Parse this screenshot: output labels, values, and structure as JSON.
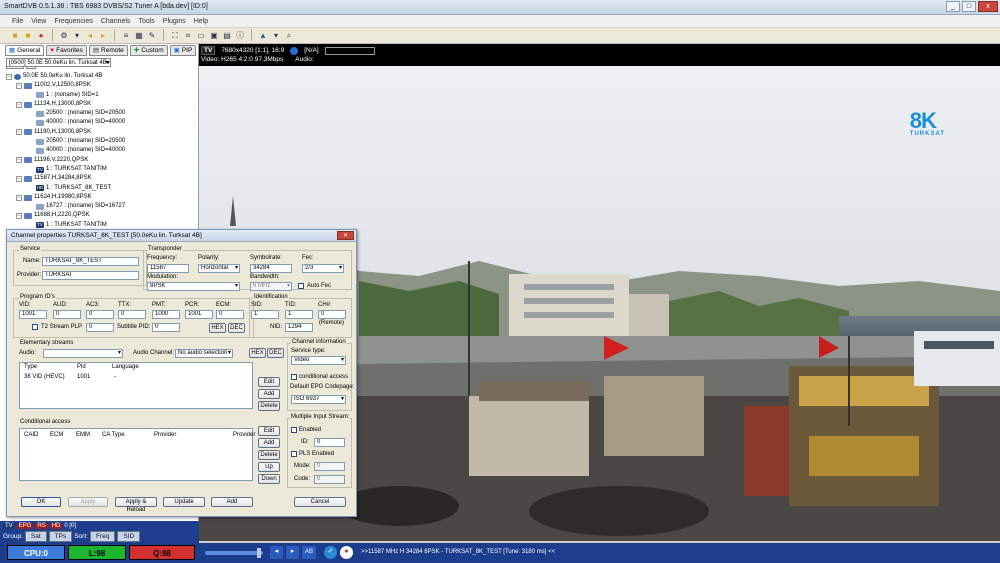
{
  "window": {
    "title": "SmartDVB 0.5.1.38 : TBS 6983 DVBS/S2 Tuner A [bda.dev]  [ID:0]",
    "min": "_",
    "max": "□",
    "close": "x"
  },
  "menu": [
    "File",
    "View",
    "Frequencies",
    "Channels",
    "Tools",
    "Plugins",
    "Help"
  ],
  "left_panel": {
    "tabs": [
      "General",
      "Favorites",
      "Remote",
      "Custom",
      "PIP"
    ],
    "channel_select": "[0500] 50.0E 50.0eKu lin. Turksat 4B",
    "tree": [
      {
        "level": 0,
        "icon": "sat",
        "text": "50.0E 50.0eKu lin. Turksat 4B"
      },
      {
        "level": 1,
        "icon": "tp",
        "text": "11002,V,12500,8PSK"
      },
      {
        "level": 2,
        "icon": "svc",
        "text": "1 : (noname) SID=1"
      },
      {
        "level": 1,
        "icon": "tp",
        "text": "11134,H,13000,8PSK"
      },
      {
        "level": 2,
        "icon": "svc",
        "text": "20500 : (noname) SID=20500"
      },
      {
        "level": 2,
        "icon": "svc",
        "text": "40000 : (noname) SID=40000"
      },
      {
        "level": 1,
        "icon": "tp",
        "text": "11190,H,13000,8PSK"
      },
      {
        "level": 2,
        "icon": "svc",
        "text": "20500 : (noname) SID=20500"
      },
      {
        "level": 2,
        "icon": "svc",
        "text": "40000 : (noname) SID=40000"
      },
      {
        "level": 1,
        "icon": "tp",
        "text": "11196,V,2220,QPSK"
      },
      {
        "level": 2,
        "icon": "tv",
        "text": "1 : TURKSAT TANITIM"
      },
      {
        "level": 1,
        "icon": "tp",
        "text": "11587,H,34284,8PSK"
      },
      {
        "level": 2,
        "icon": "hd",
        "text": "1 : TURKSAT_8K_TEST"
      },
      {
        "level": 1,
        "icon": "tp",
        "text": "11624,H,19980,8PSK"
      },
      {
        "level": 2,
        "icon": "svc",
        "text": "16727 : (noname) SID=16727"
      },
      {
        "level": 1,
        "icon": "tp",
        "text": "11688,H,2220,QPSK"
      },
      {
        "level": 2,
        "icon": "tv",
        "text": "1 : TURKSAT TANITIM"
      }
    ],
    "status_pills": [
      "TV",
      "EPG",
      "RS",
      "HD",
      "0 [0]"
    ],
    "group_label": "Group:",
    "group_buttons": [
      "Sat",
      "TPs"
    ],
    "sort_label": "Sort:",
    "sort_buttons": [
      "Freq",
      "SID"
    ]
  },
  "video": {
    "tv_badge": "TV",
    "resolution": "7680x4320 [1:1], 16:9",
    "audio_state": "[N/A]",
    "codec_info": "Video: H265  4:2:0  97.3Mbps",
    "audio_label": "Audio:",
    "logo_text": "8K",
    "logo_sub": "TURKSAT"
  },
  "statusbar": {
    "cpu": "CPU:0",
    "level": "L:98",
    "quality": "Q:98",
    "info": ">>11587 MHz H 34284 8PSK - TURKSAT_8K_TEST [Tune: 3180 ms] <<",
    "buttons": [
      "◂",
      "▸",
      "AB",
      "✓",
      "●"
    ]
  },
  "dialog": {
    "title": "Channel properties TURKSAT_8K_TEST [50.0eKu lin. Turksat 4B]",
    "service": {
      "group": "Service",
      "name_label": "Name:",
      "name": "TURKSAT_8K_TEST",
      "provider_label": "Provider:",
      "provider": "TURKSAT"
    },
    "transponder": {
      "group": "Transponder",
      "freq_label": "Frequency:",
      "freq": "11587",
      "pol_label": "Polarity:",
      "pol": "Horizontal",
      "sym_label": "Symbolrate:",
      "sym": "34284",
      "fec_label": "Fec:",
      "fec": "2/3",
      "mod_label": "Modulation:",
      "mod": "8PSK",
      "bw_label": "Bandwidth:",
      "bw": "6 MHz",
      "autofec_label": "Auto Fec"
    },
    "pids": {
      "group": "Program ID's",
      "vid_label": "VID:",
      "vid": "1001",
      "aud_label": "AUD:",
      "aud": "0",
      "ac3_label": "AC3:",
      "ac3": "0",
      "ttx_label": "TTX:",
      "ttx": "0",
      "pmt_label": "PMT:",
      "pmt": "1000",
      "pcr_label": "PCR:",
      "pcr": "1001",
      "ecm_label": "ECM:",
      "ecm": "0",
      "t2_label": "T2 Stream PLP",
      "t2": "0",
      "sub_label": "Subtitle PID:",
      "sub": "0",
      "hex": "HEX",
      "dec": "DEC"
    },
    "ident": {
      "group": "Identification",
      "sid_label": "SID:",
      "sid": "1",
      "tid_label": "TID:",
      "tid": "1",
      "ch_label": "CH#:",
      "ch": "0",
      "remote": "(Remote)",
      "nid_label": "NID:",
      "nid": "1294"
    },
    "elementary": {
      "group": "Elementary streams",
      "audio_label": "Audio:",
      "audio_channel_label": "Audio Channel:",
      "audio_channel": "No audio selection",
      "hex": "HEX",
      "dec": "DEC",
      "cols": [
        "Type",
        "Pid",
        "Language"
      ],
      "rows": [
        [
          "36 VID (HEVC)",
          "1001",
          "-"
        ]
      ],
      "buttons": [
        "Edit",
        "Add",
        "Delete"
      ]
    },
    "chinfo": {
      "group": "Channel information",
      "svc_type_label": "Service type:",
      "svc_type": "Video",
      "cond_label": "conditional access",
      "epg_label": "Default EPG Codepage:",
      "epg": "ISO 6937"
    },
    "multi": {
      "group": "Multiple Input Stream:",
      "enabled": "Enabled",
      "id_label": "ID:",
      "id": "0",
      "pls": "PLS Enabled",
      "mode_label": "Mode:",
      "mode": "0",
      "code_label": "Code:",
      "code": "0"
    },
    "ca": {
      "group": "Conditional access",
      "cols": [
        "CAID",
        "ECM",
        "EMM",
        "CA Type",
        "Provider",
        "Provider"
      ],
      "buttons": [
        "Edit",
        "Add",
        "Delete",
        "Up",
        "Down"
      ]
    },
    "footer": [
      "OK",
      "Apply",
      "Apply & Reload",
      "Update",
      "Add",
      "Cancel"
    ]
  }
}
